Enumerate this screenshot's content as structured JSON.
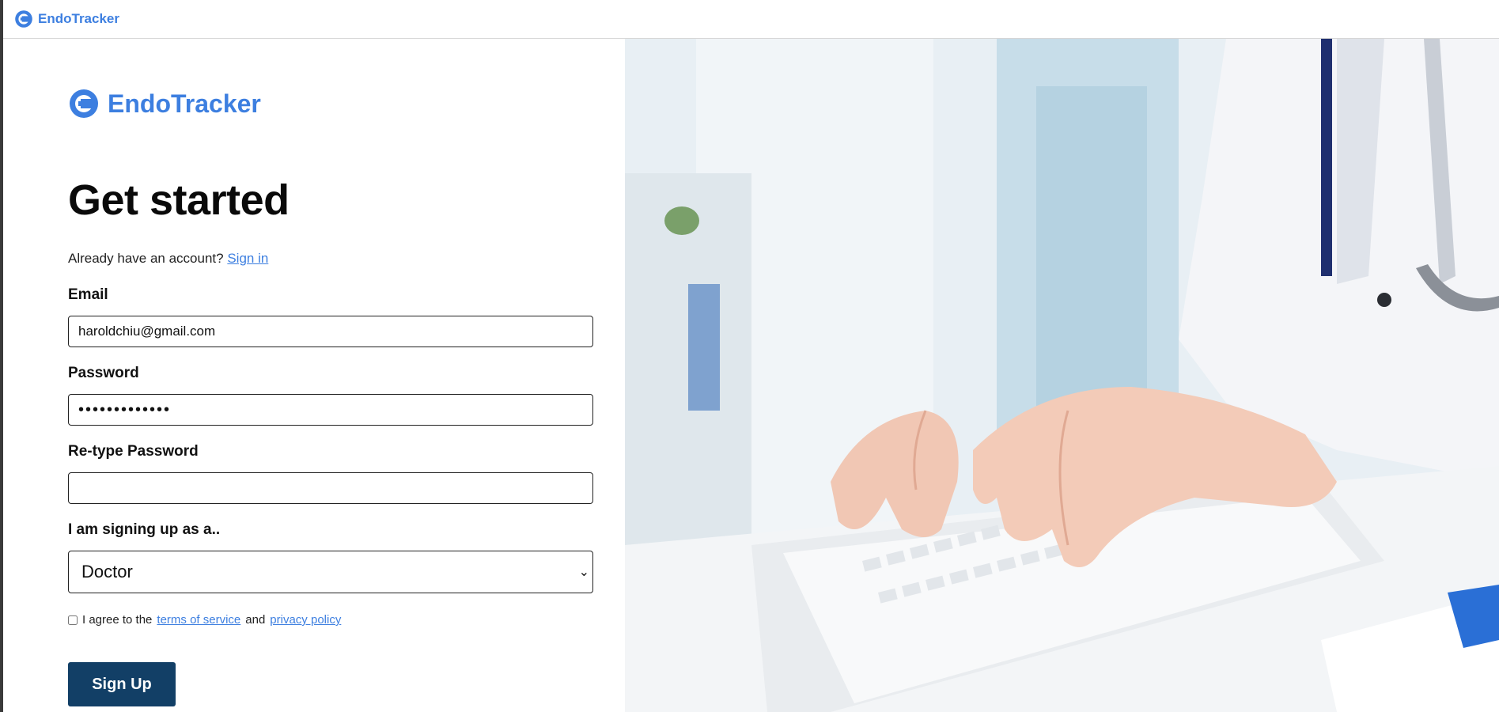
{
  "app": {
    "name": "EndoTracker"
  },
  "topbar": {
    "brand": "EndoTracker",
    "logo_icon": "endotracker-logo-icon"
  },
  "form": {
    "brand": "EndoTracker",
    "title": "Get started",
    "have_account_text": "Already have an account?",
    "sign_in_link": "Sign in",
    "email": {
      "label": "Email",
      "value": "haroldchiu@gmail.com"
    },
    "password": {
      "label": "Password",
      "value": "•••••••••••••"
    },
    "retype_password": {
      "label": "Re-type Password",
      "value": ""
    },
    "role": {
      "label": "I am signing up as a..",
      "selected": "Doctor"
    },
    "agree": {
      "prefix": "I agree to the",
      "terms_link": "terms of service",
      "and": "and",
      "privacy_link": "privacy policy",
      "checked": false
    },
    "submit_label": "Sign Up"
  },
  "colors": {
    "brand": "#3d7fe0",
    "button": "#123f66"
  },
  "hero": {
    "image_icon": "doctor-typing-keyboard-photo"
  }
}
